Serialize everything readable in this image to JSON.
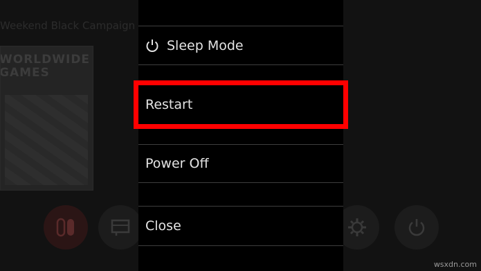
{
  "background": {
    "user_line": "Weekend Black Campaign",
    "game_tile_logo": "WORLDWIDE\nGAMES"
  },
  "dock_icons": [
    "nintendo-eshop-icon",
    "news-icon",
    "album-folder-icon",
    "album-icon",
    "controllers-icon",
    "settings-gear-icon",
    "power-icon"
  ],
  "power_menu": {
    "sleep_mode_label": "Sleep Mode",
    "restart_label": "Restart",
    "power_off_label": "Power Off",
    "close_label": "Close",
    "highlight_color": "#ff0000"
  },
  "watermark": "wsxdn.com"
}
